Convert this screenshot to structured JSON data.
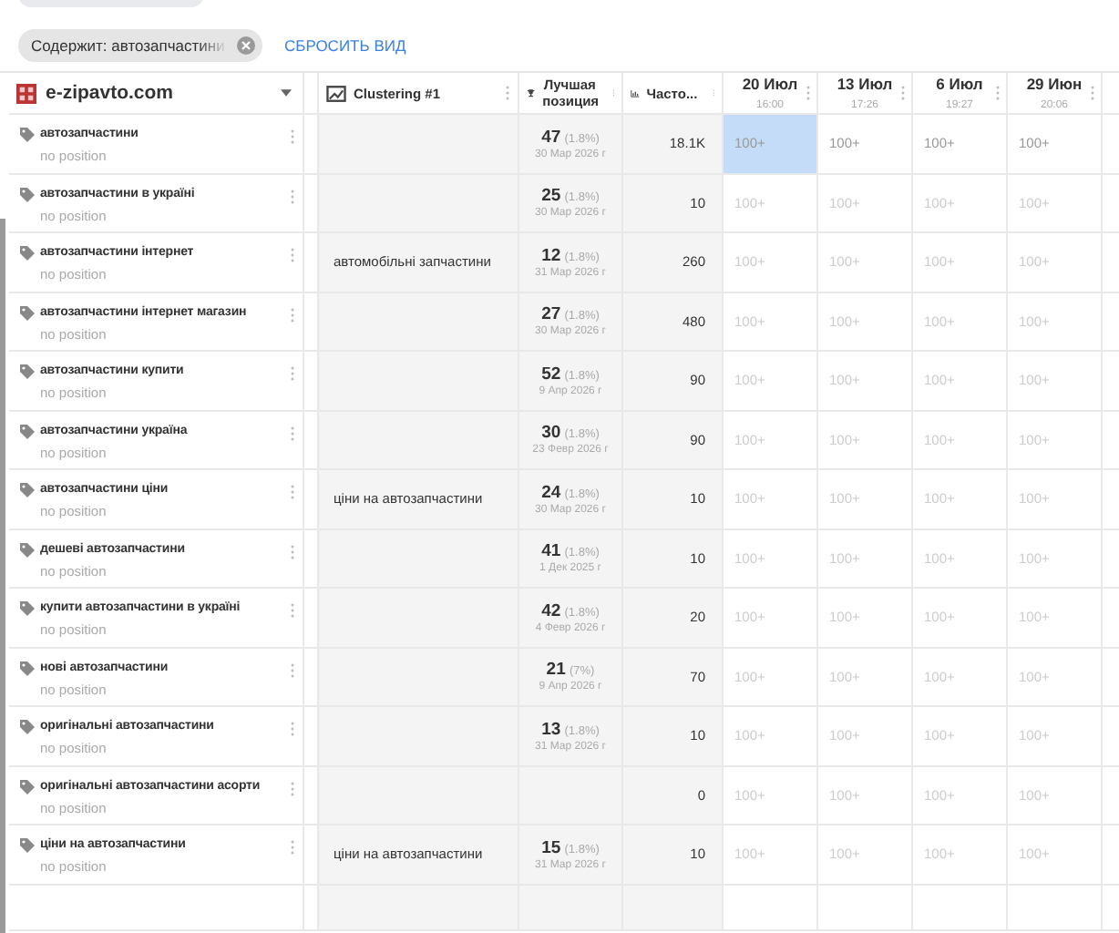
{
  "filter_bar": {
    "chip": {
      "label": "Содержит: автозапчастини"
    },
    "reset_link": "СБРОСИТЬ ВИД"
  },
  "table": {
    "project": "e-zipavto.com",
    "columns": [
      {
        "kind": "cluster",
        "label": "Clustering #1"
      },
      {
        "kind": "best",
        "label": "Лучшая позиция"
      },
      {
        "kind": "freq",
        "label": "Часто..."
      }
    ],
    "dates": [
      {
        "date": "20 Июл",
        "time": "16:00"
      },
      {
        "date": "13 Июл",
        "time": "17:26"
      },
      {
        "date": "6 Июл",
        "time": "19:27"
      },
      {
        "date": "29 Июн",
        "time": "20:06"
      }
    ],
    "rows": [
      {
        "keyword": "автозапчастини",
        "status": "no position",
        "cluster": "",
        "best": "47",
        "best_share": "(1.8%)",
        "best_date": "30 Мар 2026 г",
        "freq": "18.1K",
        "active": true,
        "positions": [
          {
            "text": "100+",
            "selected": true
          },
          {
            "text": "100+",
            "selected": false
          },
          {
            "text": "100+",
            "selected": false
          },
          {
            "text": "100+",
            "selected": false
          }
        ]
      },
      {
        "keyword": "автозапчастини в україні",
        "status": "no position",
        "cluster": "",
        "best": "25",
        "best_share": "(1.8%)",
        "best_date": "30 Мар 2026 г",
        "freq": "10",
        "active": false,
        "positions": [
          {
            "text": "100+",
            "selected": false
          },
          {
            "text": "100+",
            "selected": false
          },
          {
            "text": "100+",
            "selected": false
          },
          {
            "text": "100+",
            "selected": false
          }
        ]
      },
      {
        "keyword": "автозапчастини інтернет",
        "status": "no position",
        "cluster": "автомобільні запчастини",
        "best": "12",
        "best_share": "(1.8%)",
        "best_date": "31 Мар 2026 г",
        "freq": "260",
        "active": false,
        "positions": [
          {
            "text": "100+",
            "selected": false
          },
          {
            "text": "100+",
            "selected": false
          },
          {
            "text": "100+",
            "selected": false
          },
          {
            "text": "100+",
            "selected": false
          }
        ]
      },
      {
        "keyword": "автозапчастини інтернет магазин",
        "status": "no position",
        "cluster": "",
        "best": "27",
        "best_share": "(1.8%)",
        "best_date": "30 Мар 2026 г",
        "freq": "480",
        "active": false,
        "positions": [
          {
            "text": "100+",
            "selected": false
          },
          {
            "text": "100+",
            "selected": false
          },
          {
            "text": "100+",
            "selected": false
          },
          {
            "text": "100+",
            "selected": false
          }
        ]
      },
      {
        "keyword": "автозапчастини купити",
        "status": "no position",
        "cluster": "",
        "best": "52",
        "best_share": "(1.8%)",
        "best_date": "9 Апр 2026 г",
        "freq": "90",
        "active": false,
        "positions": [
          {
            "text": "100+",
            "selected": false
          },
          {
            "text": "100+",
            "selected": false
          },
          {
            "text": "100+",
            "selected": false
          },
          {
            "text": "100+",
            "selected": false
          }
        ]
      },
      {
        "keyword": "автозапчастини україна",
        "status": "no position",
        "cluster": "",
        "best": "30",
        "best_share": "(1.8%)",
        "best_date": "23 Февр 2026 г",
        "freq": "90",
        "active": false,
        "positions": [
          {
            "text": "100+",
            "selected": false
          },
          {
            "text": "100+",
            "selected": false
          },
          {
            "text": "100+",
            "selected": false
          },
          {
            "text": "100+",
            "selected": false
          }
        ]
      },
      {
        "keyword": "автозапчастини ціни",
        "status": "no position",
        "cluster": "ціни на автозапчастини",
        "best": "24",
        "best_share": "(1.8%)",
        "best_date": "30 Мар 2026 г",
        "freq": "10",
        "active": false,
        "positions": [
          {
            "text": "100+",
            "selected": false
          },
          {
            "text": "100+",
            "selected": false
          },
          {
            "text": "100+",
            "selected": false
          },
          {
            "text": "100+",
            "selected": false
          }
        ]
      },
      {
        "keyword": "дешеві автозапчастини",
        "status": "no position",
        "cluster": "",
        "best": "41",
        "best_share": "(1.8%)",
        "best_date": "1 Дек 2025 г",
        "freq": "10",
        "active": false,
        "positions": [
          {
            "text": "100+",
            "selected": false
          },
          {
            "text": "100+",
            "selected": false
          },
          {
            "text": "100+",
            "selected": false
          },
          {
            "text": "100+",
            "selected": false
          }
        ]
      },
      {
        "keyword": "купити автозапчастини в україні",
        "status": "no position",
        "cluster": "",
        "best": "42",
        "best_share": "(1.8%)",
        "best_date": "4 Февр 2026 г",
        "freq": "20",
        "active": false,
        "positions": [
          {
            "text": "100+",
            "selected": false
          },
          {
            "text": "100+",
            "selected": false
          },
          {
            "text": "100+",
            "selected": false
          },
          {
            "text": "100+",
            "selected": false
          }
        ]
      },
      {
        "keyword": "нові автозапчастини",
        "status": "no position",
        "cluster": "",
        "best": "21",
        "best_share": "(7%)",
        "best_date": "9 Апр 2026 г",
        "freq": "70",
        "active": false,
        "positions": [
          {
            "text": "100+",
            "selected": false
          },
          {
            "text": "100+",
            "selected": false
          },
          {
            "text": "100+",
            "selected": false
          },
          {
            "text": "100+",
            "selected": false
          }
        ]
      },
      {
        "keyword": "оригінальні автозапчастини",
        "status": "no position",
        "cluster": "",
        "best": "13",
        "best_share": "(1.8%)",
        "best_date": "31 Мар 2026 г",
        "freq": "10",
        "active": false,
        "positions": [
          {
            "text": "100+",
            "selected": false
          },
          {
            "text": "100+",
            "selected": false
          },
          {
            "text": "100+",
            "selected": false
          },
          {
            "text": "100+",
            "selected": false
          }
        ]
      },
      {
        "keyword": "оригінальні автозапчастини асорти",
        "status": "no position",
        "cluster": "",
        "best": "",
        "best_share": "",
        "best_date": "",
        "freq": "0",
        "active": false,
        "positions": [
          {
            "text": "100+",
            "selected": false
          },
          {
            "text": "100+",
            "selected": false
          },
          {
            "text": "100+",
            "selected": false
          },
          {
            "text": "100+",
            "selected": false
          }
        ]
      },
      {
        "keyword": "ціни на автозапчастини",
        "status": "no position",
        "cluster": "ціни на автозапчастини",
        "best": "15",
        "best_share": "(1.8%)",
        "best_date": "31 Мар 2026 г",
        "freq": "10",
        "active": false,
        "positions": [
          {
            "text": "100+",
            "selected": false
          },
          {
            "text": "100+",
            "selected": false
          },
          {
            "text": "100+",
            "selected": false
          },
          {
            "text": "100+",
            "selected": false
          }
        ]
      }
    ]
  }
}
